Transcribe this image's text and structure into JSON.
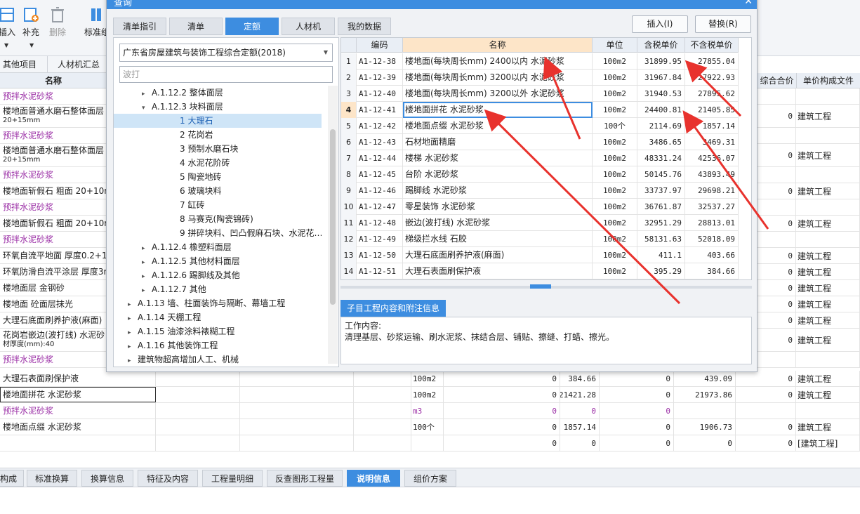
{
  "toolbar": {
    "insert": "插入",
    "supplement": "补充",
    "delete": "删除",
    "standard": "标准组"
  },
  "subtabs": [
    "其他项目",
    "人材机汇总"
  ],
  "main_headers": {
    "name": "名称",
    "total_price": "综合合价",
    "file": "单价构成文件"
  },
  "main_rows": [
    {
      "name": "预拌水泥砂浆",
      "purple": true,
      "qty": "",
      "total": "",
      "file": ""
    },
    {
      "name": "楼地面普通水磨石整体面层",
      "sub": "20+15mm",
      "qty": "",
      "total": "0",
      "file": "建筑工程"
    },
    {
      "name": "预拌水泥砂浆",
      "purple": true,
      "qty": "",
      "total": "",
      "file": ""
    },
    {
      "name": "楼地面普通水磨石整体面层",
      "sub": "20+15mm",
      "qty": "",
      "total": "0",
      "file": "建筑工程"
    },
    {
      "name": "预拌水泥砂浆",
      "purple": true,
      "qty": "",
      "total": "",
      "file": ""
    },
    {
      "name": "楼地面斩假石 粗面 20+10mm",
      "qty": "",
      "total": "0",
      "file": "建筑工程"
    },
    {
      "name": "预拌水泥砂浆",
      "purple": true,
      "qty": "",
      "total": "",
      "file": ""
    },
    {
      "name": "楼地面斩假石 粗面 20+10mm",
      "qty": "",
      "total": "0",
      "file": "建筑工程"
    },
    {
      "name": "预拌水泥砂浆",
      "purple": true,
      "qty": "",
      "total": "",
      "file": ""
    },
    {
      "name": "环氧自流平地面 厚度0.2+1",
      "qty": "",
      "total": "0",
      "file": "建筑工程"
    },
    {
      "name": "环氧防滑自流平涂层 厚度3m",
      "qty": "",
      "total": "0",
      "file": "建筑工程"
    },
    {
      "name": "楼地面层 金钢砂",
      "qty": "",
      "total": "0",
      "file": "建筑工程"
    },
    {
      "name": "楼地面 砼面层抹光",
      "qty": "",
      "total": "0",
      "file": "建筑工程"
    },
    {
      "name": "大理石底面刷养护液(麻面)",
      "qty": "",
      "total": "0",
      "file": "建筑工程"
    },
    {
      "name": "花岗岩嵌边(波打线) 水泥砂",
      "sub": "材厚度(mm):40",
      "qty": "",
      "total": "0",
      "file": "建筑工程"
    },
    {
      "name": "预拌水泥砂浆",
      "purple": true,
      "qty": "",
      "total": "",
      "file": ""
    }
  ],
  "lower_rows": [
    {
      "name": "大理石表面刷保护液",
      "unit": "100m2",
      "c1": "0",
      "price": "384.66",
      "c3": "0",
      "c4": "439.09",
      "total": "0",
      "file": "建筑工程"
    },
    {
      "name": "楼地面拼花 水泥砂浆",
      "unit": "100m2",
      "c1": "0",
      "price": "21421.28",
      "c3": "0",
      "c4": "21973.86",
      "total": "0",
      "file": "建筑工程"
    },
    {
      "name": "预拌水泥砂浆",
      "purple": true,
      "unit": "m3",
      "c1": "0",
      "price": "0",
      "c3": "0",
      "c4": "",
      "total": "",
      "file": ""
    },
    {
      "name": "楼地面点缀 水泥砂浆",
      "unit": "100个",
      "c1": "0",
      "price": "1857.14",
      "c3": "0",
      "c4": "1906.73",
      "total": "0",
      "file": "建筑工程"
    },
    {
      "name": "",
      "unit": "",
      "c1": "0",
      "price": "0",
      "c3": "0",
      "c4": "0",
      "total": "0",
      "file": "[建筑工程]"
    }
  ],
  "bottom_tabs": [
    "构成",
    "标准换算",
    "换算信息",
    "特征及内容",
    "工程量明细",
    "反查图形工程量",
    "说明信息",
    "组价方案"
  ],
  "bottom_active": "说明信息",
  "dialog": {
    "title": "查询",
    "tabs": [
      "清单指引",
      "清单",
      "定额",
      "人材机",
      "我的数据"
    ],
    "active_tab": "定额",
    "insert_button": "插入(I)",
    "replace_button": "替换(R)",
    "quota_library": "广东省房屋建筑与装饰工程综合定额(2018)",
    "search_placeholder": "波打",
    "tree": [
      {
        "label": "A.1.12.2 整体面层",
        "indent": 2,
        "arrow": "▸"
      },
      {
        "label": "A.1.12.3 块料面层",
        "indent": 2,
        "arrow": "▾"
      },
      {
        "label": "1 大理石",
        "indent": 4,
        "arrow": "",
        "selected": true
      },
      {
        "label": "2 花岗岩",
        "indent": 4,
        "arrow": ""
      },
      {
        "label": "3 预制水磨石块",
        "indent": 4,
        "arrow": ""
      },
      {
        "label": "4 水泥花阶砖",
        "indent": 4,
        "arrow": ""
      },
      {
        "label": "5 陶瓷地砖",
        "indent": 4,
        "arrow": ""
      },
      {
        "label": "6 玻璃块料",
        "indent": 4,
        "arrow": ""
      },
      {
        "label": "7 缸砖",
        "indent": 4,
        "arrow": ""
      },
      {
        "label": "8 马赛克(陶瓷锦砖)",
        "indent": 4,
        "arrow": ""
      },
      {
        "label": "9 拼碎块料、凹凸假麻石块、水泥花…",
        "indent": 4,
        "arrow": ""
      },
      {
        "label": "A.1.12.4 橡塑料面层",
        "indent": 2,
        "arrow": "▸"
      },
      {
        "label": "A.1.12.5 其他材料面层",
        "indent": 2,
        "arrow": "▸"
      },
      {
        "label": "A.1.12.6 踢脚线及其他",
        "indent": 2,
        "arrow": "▸"
      },
      {
        "label": "A.1.12.7 其他",
        "indent": 2,
        "arrow": "▸"
      },
      {
        "label": "A.1.13 墙、柱面装饰与隔断、幕墙工程",
        "indent": 1,
        "arrow": "▸"
      },
      {
        "label": "A.1.14 天棚工程",
        "indent": 1,
        "arrow": "▸"
      },
      {
        "label": "A.1.15 油漆涂料裱糊工程",
        "indent": 1,
        "arrow": "▸"
      },
      {
        "label": "A.1.16 其他装饰工程",
        "indent": 1,
        "arrow": "▸"
      },
      {
        "label": "建筑物超高增加人工、机械",
        "indent": 1,
        "arrow": "▸"
      }
    ],
    "grid_headers": {
      "code": "编码",
      "name": "名称",
      "unit": "单位",
      "tax_price": "含税单价",
      "notax_price": "不含税单价"
    },
    "grid_rows": [
      {
        "no": "1",
        "code": "A1-12-38",
        "name": "楼地面(每块周长mm) 2400以内 水泥砂浆",
        "unit": "100m2",
        "tax": "31899.95",
        "notax": "27855.04"
      },
      {
        "no": "2",
        "code": "A1-12-39",
        "name": "楼地面(每块周长mm) 3200以内 水泥砂浆",
        "unit": "100m2",
        "tax": "31967.84",
        "notax": "27922.93"
      },
      {
        "no": "3",
        "code": "A1-12-40",
        "name": "楼地面(每块周长mm) 3200以外 水泥砂浆",
        "unit": "100m2",
        "tax": "31940.53",
        "notax": "27895.62"
      },
      {
        "no": "4",
        "code": "A1-12-41",
        "name": "楼地面拼花 水泥砂浆",
        "unit": "100m2",
        "tax": "24400.81",
        "notax": "21405.85",
        "selected": true
      },
      {
        "no": "5",
        "code": "A1-12-42",
        "name": "楼地面点缀 水泥砂浆",
        "unit": "100个",
        "tax": "2114.69",
        "notax": "1857.14"
      },
      {
        "no": "6",
        "code": "A1-12-43",
        "name": "石材地面精磨",
        "unit": "100m2",
        "tax": "3486.65",
        "notax": "3469.31"
      },
      {
        "no": "7",
        "code": "A1-12-44",
        "name": "楼梯 水泥砂浆",
        "unit": "100m2",
        "tax": "48331.24",
        "notax": "42536.07"
      },
      {
        "no": "8",
        "code": "A1-12-45",
        "name": "台阶 水泥砂浆",
        "unit": "100m2",
        "tax": "50145.76",
        "notax": "43893.49"
      },
      {
        "no": "9",
        "code": "A1-12-46",
        "name": "踢脚线 水泥砂浆",
        "unit": "100m2",
        "tax": "33737.97",
        "notax": "29698.21"
      },
      {
        "no": "10",
        "code": "A1-12-47",
        "name": "零星装饰 水泥砂浆",
        "unit": "100m2",
        "tax": "36761.87",
        "notax": "32537.27"
      },
      {
        "no": "11",
        "code": "A1-12-48",
        "name": "嵌边(波打线) 水泥砂浆",
        "unit": "100m2",
        "tax": "32951.29",
        "notax": "28813.01"
      },
      {
        "no": "12",
        "code": "A1-12-49",
        "name": "梯级拦水线 石胶",
        "unit": "100m2",
        "tax": "58131.63",
        "notax": "52018.09"
      },
      {
        "no": "13",
        "code": "A1-12-50",
        "name": "大理石底面刷养护液(麻面)",
        "unit": "100m2",
        "tax": "411.1",
        "notax": "403.66"
      },
      {
        "no": "14",
        "code": "A1-12-51",
        "name": "大理石表面刷保护液",
        "unit": "100m2",
        "tax": "395.29",
        "notax": "384.66"
      }
    ],
    "info_tab": "子目工程内容和附注信息",
    "info_title": "工作内容:",
    "info_text": "清理基层、砂浆运输、刷水泥浆、抹结合层、铺贴、擦缝、打蜡、擦光。"
  },
  "colors": {
    "accent": "#3d8de0",
    "purple": "#9b2fa6",
    "arrow": "#e8322d"
  }
}
